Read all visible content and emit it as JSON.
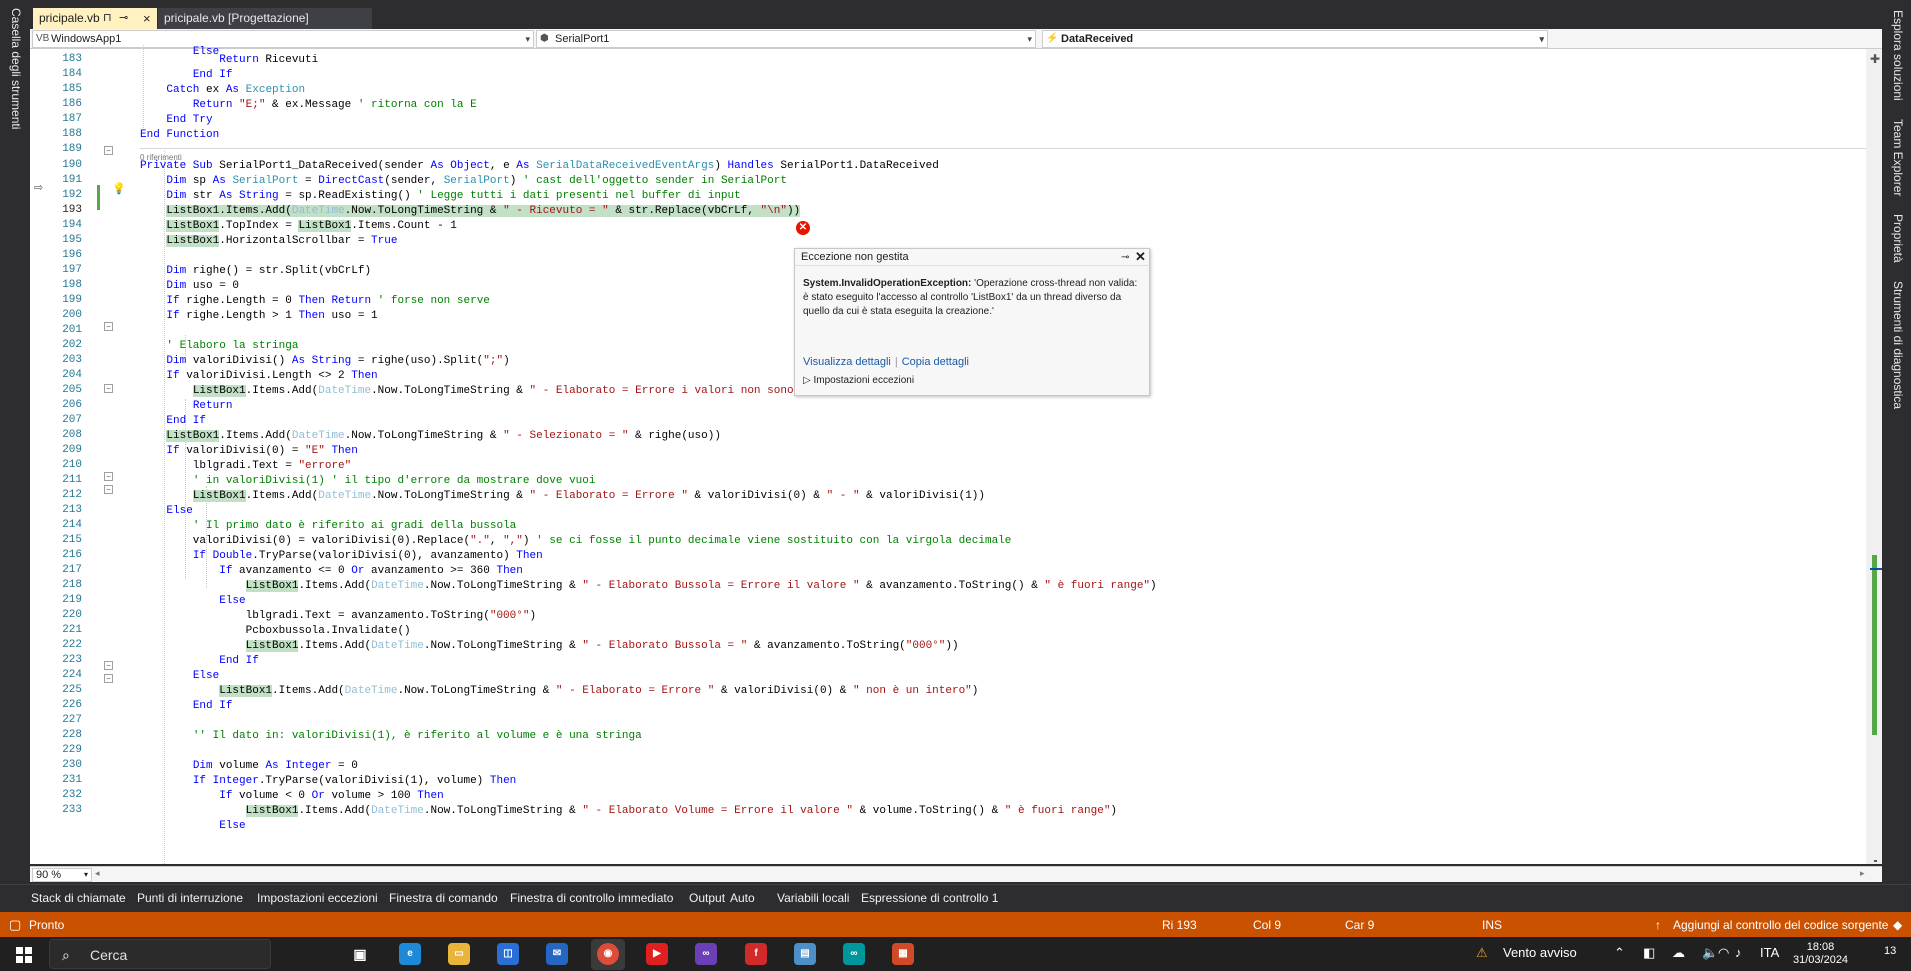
{
  "left_toolbox": {
    "label": "Casella degli strumenti"
  },
  "right_panels": [
    "Esplora soluzioni",
    "Team Explorer",
    "Proprietà",
    "Strumenti di diagnostica"
  ],
  "tabs": [
    {
      "label": "pricipale.vb",
      "pin": "⊓",
      "close": "×",
      "pushpin": "⊸",
      "active": true
    },
    {
      "label": "pricipale.vb [Progettazione]"
    }
  ],
  "navbar": {
    "project": "WindowsApp1",
    "object": "SerialPort1",
    "event": "DataReceived"
  },
  "editor": {
    "references_label": "0 riferimenti",
    "current_line": "193",
    "line_numbers": [
      "183",
      "184",
      "185",
      "186",
      "187",
      "188",
      "189",
      "190",
      "191",
      "192",
      "193",
      "194",
      "195",
      "196",
      "197",
      "198",
      "199",
      "200",
      "201",
      "202",
      "203",
      "204",
      "205",
      "206",
      "207",
      "208",
      "209",
      "210",
      "211",
      "212",
      "213",
      "214",
      "215",
      "216",
      "217",
      "218",
      "219",
      "220",
      "221",
      "222",
      "223",
      "224",
      "225",
      "226",
      "227",
      "228",
      "229",
      "230",
      "231",
      "232",
      "233"
    ]
  },
  "exception_popup": {
    "title": "Eccezione non gestita",
    "exception_type": "System.InvalidOperationException:",
    "message": "'Operazione cross-thread non valida: è stato eseguito l'accesso al controllo 'ListBox1' da un thread diverso da quello da cui è stata eseguita la creazione.'",
    "view_details": "Visualizza dettagli",
    "separator": "|",
    "copy_details": "Copia dettagli",
    "exception_settings": "▷ Impostazioni eccezioni"
  },
  "zoom": {
    "value": "90 %"
  },
  "tool_windows": [
    "Stack di chiamate",
    "Punti di interruzione",
    "Impostazioni eccezioni",
    "Finestra di comando",
    "Finestra di controllo immediato",
    "Output",
    "Auto",
    "Variabili locali",
    "Espressione di controllo 1"
  ],
  "status": {
    "ready": "Pronto",
    "row": "Ri 193",
    "col": "Col 9",
    "car": "Car 9",
    "mode": "INS",
    "source_control": "Aggiungi al controllo del codice sorgente"
  },
  "taskbar": {
    "search": "Cerca",
    "weather": "Vento avviso",
    "lang": "ITA",
    "time": "18:08",
    "date": "31/03/2024",
    "notif": "13"
  },
  "colors": {
    "status_bar": "#ca5100",
    "active_tab": "#fff1c0",
    "keyword": "#0000ff",
    "type": "#2b91af",
    "string": "#a31515",
    "comment": "#008000"
  }
}
